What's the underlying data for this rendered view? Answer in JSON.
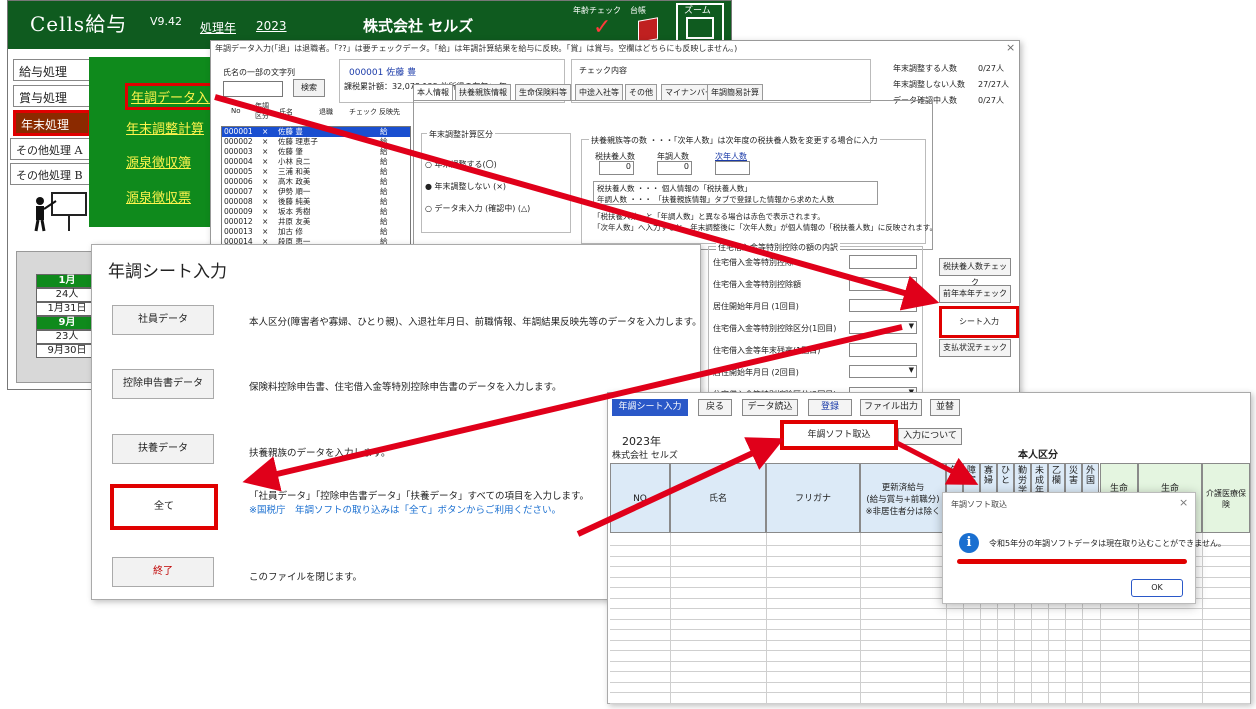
{
  "main": {
    "app_title": "Cells給与",
    "version": "V9.42",
    "fiscal_label": "処理年",
    "fiscal_year": "2023",
    "company": "株式会社 セルズ",
    "age_check": "年齢チェック",
    "ledger": "台帳",
    "zoom": "ズーム",
    "left_menu": [
      "給与処理",
      "賞与処理",
      "年末処理",
      "その他処理 A",
      "その他処理 B"
    ],
    "green_links": [
      "年調データ入力",
      "年末調整計算",
      "源泉徴収簿",
      "源泉徴収票"
    ],
    "calendar": [
      {
        "text": "1月",
        "head": true
      },
      {
        "text": "24人",
        "head": false
      },
      {
        "text": "1月31日",
        "head": false
      },
      {
        "text": "9月",
        "head": true
      },
      {
        "text": "23人",
        "head": false
      },
      {
        "text": "9月30日",
        "head": false
      }
    ]
  },
  "nencho_window": {
    "hint": "年調データ入力(「退」は退職者。「??」は要チェックデータ。「給」は年調計算結果を給与に反映。「賞」は賞与。空欄はどちらにも反映しません。)",
    "close": "×",
    "search_label": "氏名の一部の文字列",
    "search_button": "検索",
    "emp_id_name": "000001 佐藤 豊",
    "emp_taxable": "課税累計額：32,078,125  他所得の有無： 無",
    "check_label": "チェック内容",
    "counts": [
      {
        "label": "年末調整する人数",
        "value": "0/27人"
      },
      {
        "label": "年末調整しない人数",
        "value": "27/27人"
      },
      {
        "label": "データ確認中人数",
        "value": "0/27人"
      }
    ],
    "list_header": {
      "no": "No",
      "nencho": "年調",
      "kubun": "区分",
      "name": "氏名",
      "taishoku": "退職",
      "check": "チェック",
      "hanei": "反映先"
    },
    "employees": [
      {
        "no": "000001",
        "mark": "×",
        "name": "佐藤 豊",
        "dest": "給"
      },
      {
        "no": "000002",
        "mark": "×",
        "name": "佐藤 理恵子",
        "dest": "給"
      },
      {
        "no": "000003",
        "mark": "×",
        "name": "佐藤 肇",
        "dest": "給"
      },
      {
        "no": "000004",
        "mark": "×",
        "name": "小林 良二",
        "dest": "給"
      },
      {
        "no": "000005",
        "mark": "×",
        "name": "三浦 和美",
        "dest": "給"
      },
      {
        "no": "000006",
        "mark": "×",
        "name": "高木 政美",
        "dest": "給"
      },
      {
        "no": "000007",
        "mark": "×",
        "name": "伊勢 順一",
        "dest": "給"
      },
      {
        "no": "000008",
        "mark": "×",
        "name": "後藤 純美",
        "dest": "給"
      },
      {
        "no": "000009",
        "mark": "×",
        "name": "坂本 秀樹",
        "dest": "給"
      },
      {
        "no": "000012",
        "mark": "×",
        "name": "井原 友美",
        "dest": "給"
      },
      {
        "no": "000013",
        "mark": "×",
        "name": "加古 修",
        "dest": "給"
      },
      {
        "no": "000014",
        "mark": "×",
        "name": "段原 恵一",
        "dest": "給"
      }
    ],
    "tabs": [
      "本人情報",
      "扶養親族情報",
      "生命保険料等",
      "中途入社等",
      "その他",
      "マイナンバー",
      "年調簡易計算"
    ],
    "adj_title": "年末調整計算区分",
    "adj_options": [
      "年末調整する(〇)",
      "年末調整しない (×)",
      "データ未入力 (確認中) (△)"
    ],
    "dep_title": "扶養親族等の数 ・・・「次年人数」は次年度の税扶養人数を変更する場合に入力",
    "dep_cols": [
      {
        "label": "税扶養人数",
        "value": "0"
      },
      {
        "label": "年調人数",
        "value": "0"
      },
      {
        "label": "次年人数",
        "value": ""
      }
    ],
    "dep_note1a": "税扶養人数 ・・・ 個人情報の「税扶養人数」",
    "dep_note1b": "年調人数 ・・・ 「扶養親族情報」タブで登録した情報から求めた人数",
    "dep_note2a": "「税扶養人数」と「年調人数」と異なる場合は赤色で表示されます。",
    "dep_note2b": "「次年人数」へ入力すると、年末調整後に「次年人数」が個人情報の「税扶養人数」に反映されます。",
    "housing_title": "住宅借入金等特別控除の額の内訳",
    "housing_rows": [
      "住宅借入金等特別控除",
      "住宅借入金等特別控除額",
      "居住開始年月日 (1回目)",
      "住宅借入金等特別控除区分(1回目)",
      "住宅借入金等年末残高(1回目)",
      "居住開始年月日 (2回目)",
      "住宅借入金等特別控除区分(2回目)"
    ],
    "side_buttons": [
      "税扶養人数チェック",
      "前年本年チェック",
      "シート入力",
      "支払状況チェック"
    ]
  },
  "sheet_window": {
    "title": "年調シート入力",
    "buttons": [
      "社員データ",
      "控除申告書データ",
      "扶養データ",
      "全て",
      "終了"
    ],
    "desc_shain": "本人区分(障害者や寡婦、ひとり親)、入退社年月日、前職情報、年調結果反映先等のデータを入力します。",
    "desc_kojo": "保険料控除申告書、住宅借入金等特別控除申告書のデータを入力します。",
    "desc_fuyo": "扶養親族のデータを入力します。",
    "desc_all": "「社員データ」「控除申告書データ」「扶養データ」すべての項目を入力します。",
    "desc_all_note": "※国税庁　年調ソフトの取り込みは「全て」ボタンからご利用ください。",
    "desc_end": "このファイルを閉じます。"
  },
  "grid_window": {
    "toolbar": [
      "年調シート入力",
      "戻る",
      "データ読込",
      "登録",
      "ファイル出力",
      "並替"
    ],
    "soft_import": "年調ソフト取込",
    "about_input": "入力について",
    "year": "2023年",
    "company": "株式会社 セルズ",
    "section_label": "本人区分",
    "headers": {
      "no": "NO",
      "name": "氏名",
      "kana": "フリガナ",
      "renewed": "更新済給与",
      "renewed2": "(給与賞与+前職分)",
      "renewed3": "※非居住者分は除く",
      "seimei1": "生命",
      "seimei2": "生命",
      "kaigo": "介護医療保険"
    },
    "narrow_headers": [
      "年",
      "障害",
      "寡婦",
      "ひと",
      "勤労学",
      "未成年",
      "乙欄",
      "災害",
      "外国"
    ]
  },
  "msg_dialog": {
    "title": "年調ソフト取込",
    "close": "×",
    "icon": "i",
    "text": "令和5年分の年調ソフトデータは現在取り込むことができません。",
    "ok": "OK"
  },
  "colors": {
    "header_green": "#0f5b1f",
    "panel_green": "#0f8a1c",
    "link_yellow": "#fff44d",
    "highlight_red": "#e00000",
    "selection_blue": "#1a4fd0"
  }
}
